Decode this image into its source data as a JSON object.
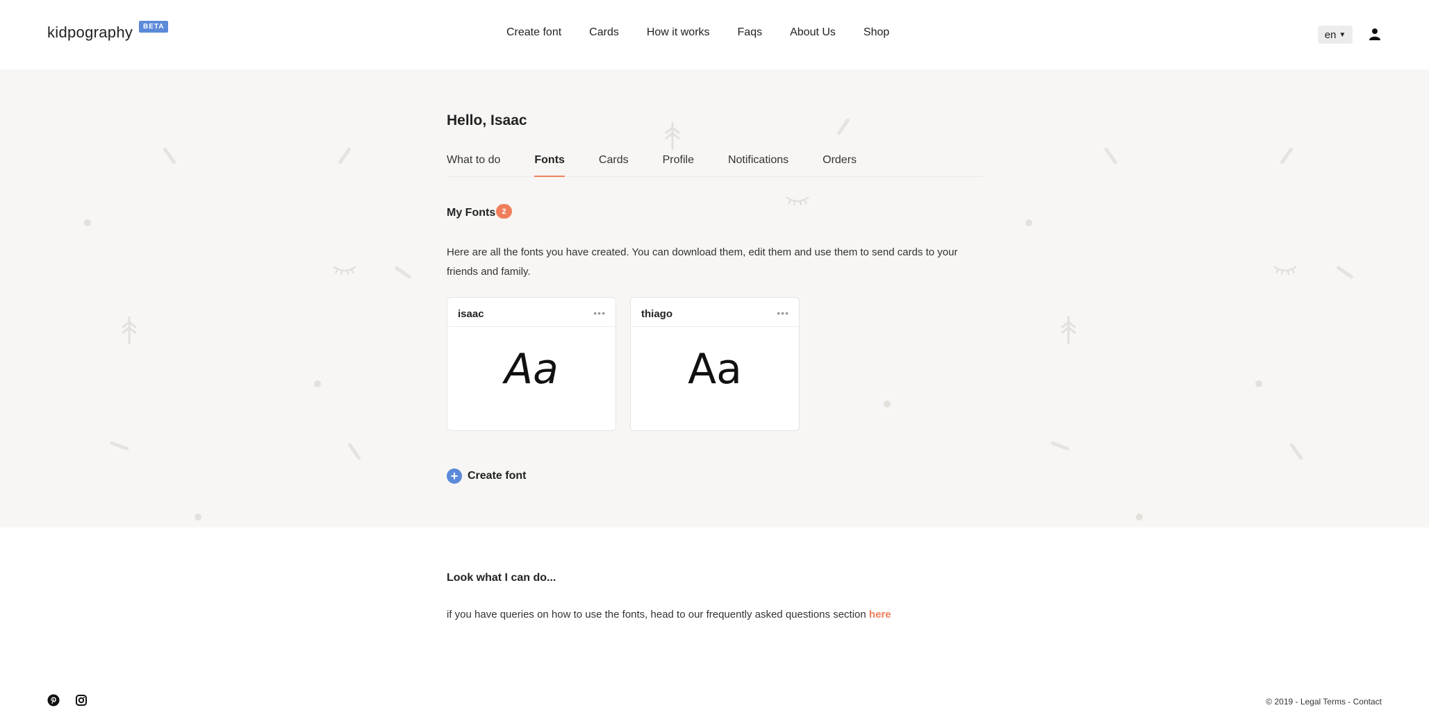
{
  "header": {
    "logo": "kidpography",
    "beta_badge": "BETA",
    "nav": [
      "Create font",
      "Cards",
      "How it works",
      "Faqs",
      "About Us",
      "Shop"
    ],
    "language": "en",
    "user_icon": "user-icon"
  },
  "profile": {
    "greeting": "Hello, Isaac",
    "tabs": [
      "What to do",
      "Fonts",
      "Cards",
      "Profile",
      "Notifications",
      "Orders"
    ],
    "active_tab": "Fonts"
  },
  "fonts": {
    "title": "My Fonts",
    "count": "2",
    "description": "Here are all the fonts you have created. You can download them, edit them and use them to send cards to your friends and family.",
    "items": [
      {
        "name": "isaac",
        "sample": "Aa",
        "menu": "•••"
      },
      {
        "name": "thiago",
        "sample": "Aa",
        "menu": "•••"
      }
    ],
    "create_label": "Create font",
    "create_icon": "+"
  },
  "showcase": {
    "title": "Look what I can do...",
    "query_text": "if you have queries on how to use the fonts, head to our frequently asked questions section",
    "query_link": "here"
  },
  "footer": {
    "social_icons": [
      "pinterest-icon",
      "instagram-icon"
    ],
    "copyright": "© 2019 - Legal Terms - Contact"
  },
  "colors": {
    "accent": "#f07e5b",
    "brand_blue": "#5b8ad9",
    "band_background": "#f7f6f4"
  }
}
